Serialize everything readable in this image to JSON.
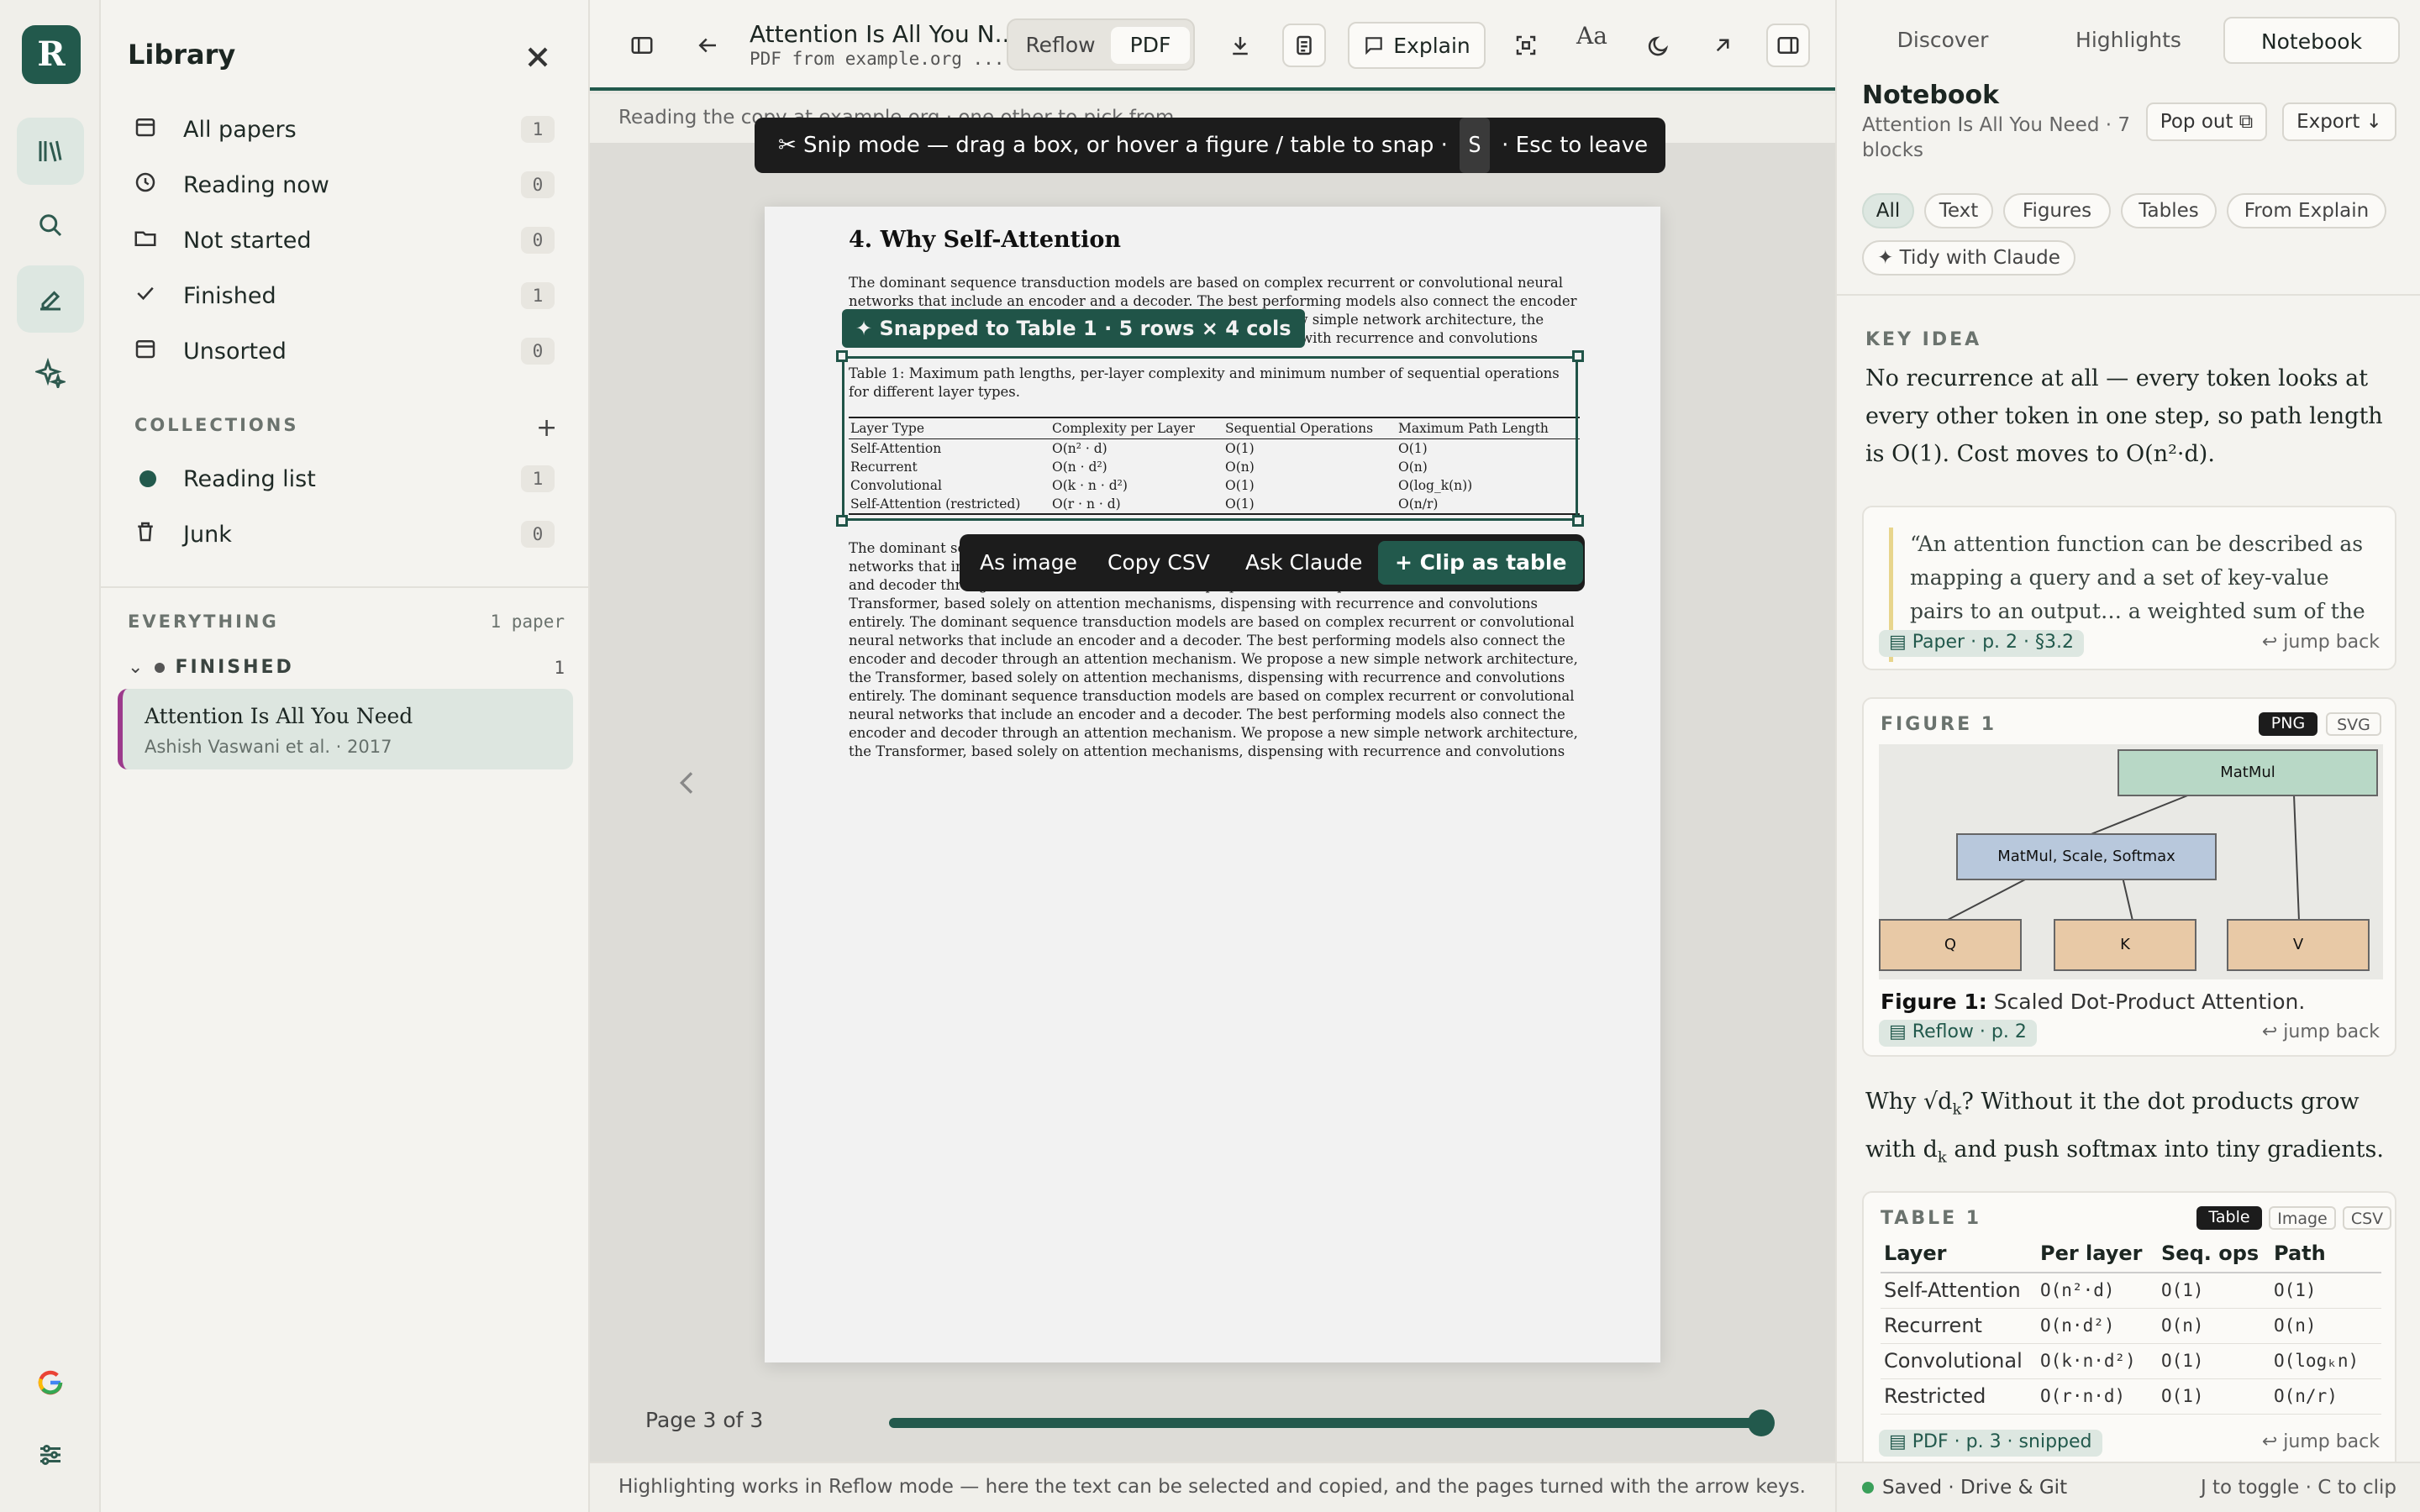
{
  "app": {
    "logo_letter": "R"
  },
  "library": {
    "title": "Library",
    "nav": [
      {
        "label": "All papers",
        "count": "1"
      },
      {
        "label": "Reading now",
        "count": "0"
      },
      {
        "label": "Not started",
        "count": "0"
      },
      {
        "label": "Finished",
        "count": "1"
      },
      {
        "label": "Unsorted",
        "count": "0"
      }
    ],
    "collections_heading": "COLLECTIONS",
    "collections": [
      {
        "label": "Reading list",
        "count": "1",
        "color": "#22594c"
      },
      {
        "label": "Junk",
        "count": "0"
      }
    ],
    "everything_heading": "EVERYTHING",
    "everything_count": "1 paper",
    "group_heading": "FINISHED",
    "group_count": "1",
    "paper": {
      "title": "Attention Is All You Need",
      "authors": "Ashish Vaswani et al. · 2017"
    }
  },
  "toolbar": {
    "doc_title": "Attention Is All You N...",
    "doc_subtitle": "PDF from example.org ...",
    "view_reflow": "Reflow",
    "view_pdf": "PDF",
    "explain": "Explain",
    "font_toggle": "Aa"
  },
  "subbar": {
    "text": "Reading the copy at example.org · one other to pick from"
  },
  "snip_banner": {
    "text": "✂ Snip mode — drag a box, or hover a figure / table to snap ·",
    "key": "S",
    "tail": "· Esc to leave"
  },
  "pdf": {
    "heading": "4. Why Self-Attention",
    "para1": "The dominant sequence transduction models are based on complex recurrent or convolutional neural networks that include an encoder and a decoder. The best performing models also connect the encoder and decoder through an attention mechanism. We propose a new simple network architecture, the Transformer, based solely on attention mechanisms, dispensing with recurrence and convolutions entirely.",
    "table_caption": "Table 1: Maximum path lengths, per-layer complexity and minimum number of sequential operations for different layer types.",
    "table_headers": [
      "Layer Type",
      "Complexity per Layer",
      "Sequential Operations",
      "Maximum Path Length"
    ],
    "table_rows": [
      [
        "Self-Attention",
        "O(n² · d)",
        "O(1)",
        "O(1)"
      ],
      [
        "Recurrent",
        "O(n · d²)",
        "O(n)",
        "O(n)"
      ],
      [
        "Convolutional",
        "O(k · n · d²)",
        "O(1)",
        "O(log_k(n))"
      ],
      [
        "Self-Attention (restricted)",
        "O(r · n · d)",
        "O(1)",
        "O(n/r)"
      ]
    ],
    "para2": "The dominant sequence transduction models are based on complex recurrent or convolutional neural networks that include an encoder and a decoder. The best performing models also connect the encoder and decoder through an attention mechanism. We propose a new simple network architecture, the Transformer, based solely on attention mechanisms, dispensing with recurrence and convolutions entirely. The dominant sequence transduction models are based on complex recurrent or convolutional neural networks that include an encoder and a decoder. The best performing models also connect the encoder and decoder through an attention mechanism. We propose a new simple network architecture, the Transformer, based solely on attention mechanisms, dispensing with recurrence and convolutions entirely. The dominant sequence transduction models are based on complex recurrent or convolutional neural networks that include an encoder and a decoder. The best performing models also connect the encoder and decoder through an attention mechanism. We propose a new simple network architecture, the Transformer, based solely on attention mechanisms, dispensing with recurrence and convolutions entirely."
  },
  "snap": {
    "badge": "✦ Snapped to Table 1 · 5 rows × 4 cols",
    "actions": {
      "as_image": "As image",
      "copy_csv": "Copy CSV",
      "ask": "Ask Claude",
      "clip": "+ Clip as table"
    }
  },
  "pager": {
    "label": "Page 3 of 3",
    "progress": 1.0
  },
  "footer": {
    "text": "Highlighting works in Reflow mode — here the text can be selected and copied, and the pages turned with the arrow keys."
  },
  "right": {
    "tabs": [
      "Discover",
      "Highlights",
      "Notebook"
    ],
    "title": "Notebook",
    "subtitle": "Attention Is All You Need · 7 blocks",
    "pop_out": "Pop out ⧉",
    "export": "Export ↓",
    "filters": [
      "All",
      "Text",
      "Figures",
      "Tables",
      "From Explain"
    ],
    "tidy": "✦ Tidy with Claude",
    "key_idea_label": "KEY IDEA",
    "key_idea": "No recurrence at all — every token looks at every other token in one step, so path length is O(1). Cost moves to O(n²·d).",
    "quote": "“An attention function can be described as mapping a query and a set of key-value pairs to an output… a weighted sum of the values.”",
    "quote_source": "▤ Paper · p. 2 · §3.2",
    "jump": "↩ jump back",
    "figure_label": "FIGURE 1",
    "figure_formats": [
      "PNG",
      "SVG"
    ],
    "figure_nodes": {
      "top": "MatMul",
      "mid": "MatMul, Scale, Softmax",
      "q": "Q",
      "k": "K",
      "v": "V"
    },
    "figure_caption_bold": "Figure 1:",
    "figure_caption": "Scaled Dot-Product Attention.",
    "figure_source": "▤ Reflow · p. 2",
    "why_a": "Why √d",
    "why_sub1": "k",
    "why_b": "? Without it the dot products grow with d",
    "why_sub2": "k",
    "why_c": " and push softmax into tiny gradients.",
    "table_label": "TABLE 1",
    "table_formats": [
      "Table",
      "Image",
      "CSV"
    ],
    "table_headers": [
      "Layer",
      "Per layer",
      "Seq. ops",
      "Path"
    ],
    "table_rows": [
      [
        "Self-Attention",
        "O(n²·d)",
        "O(1)",
        "O(1)"
      ],
      [
        "Recurrent",
        "O(n·d²)",
        "O(n)",
        "O(n)"
      ],
      [
        "Convolutional",
        "O(k·n·d²)",
        "O(1)",
        "O(logₖn)"
      ],
      [
        "Restricted",
        "O(r·n·d)",
        "O(1)",
        "O(n/r)"
      ]
    ],
    "table_source": "▤ PDF · p. 3 · snipped",
    "saved": "Saved · Drive & Git",
    "hint": "J to toggle · C to clip"
  }
}
